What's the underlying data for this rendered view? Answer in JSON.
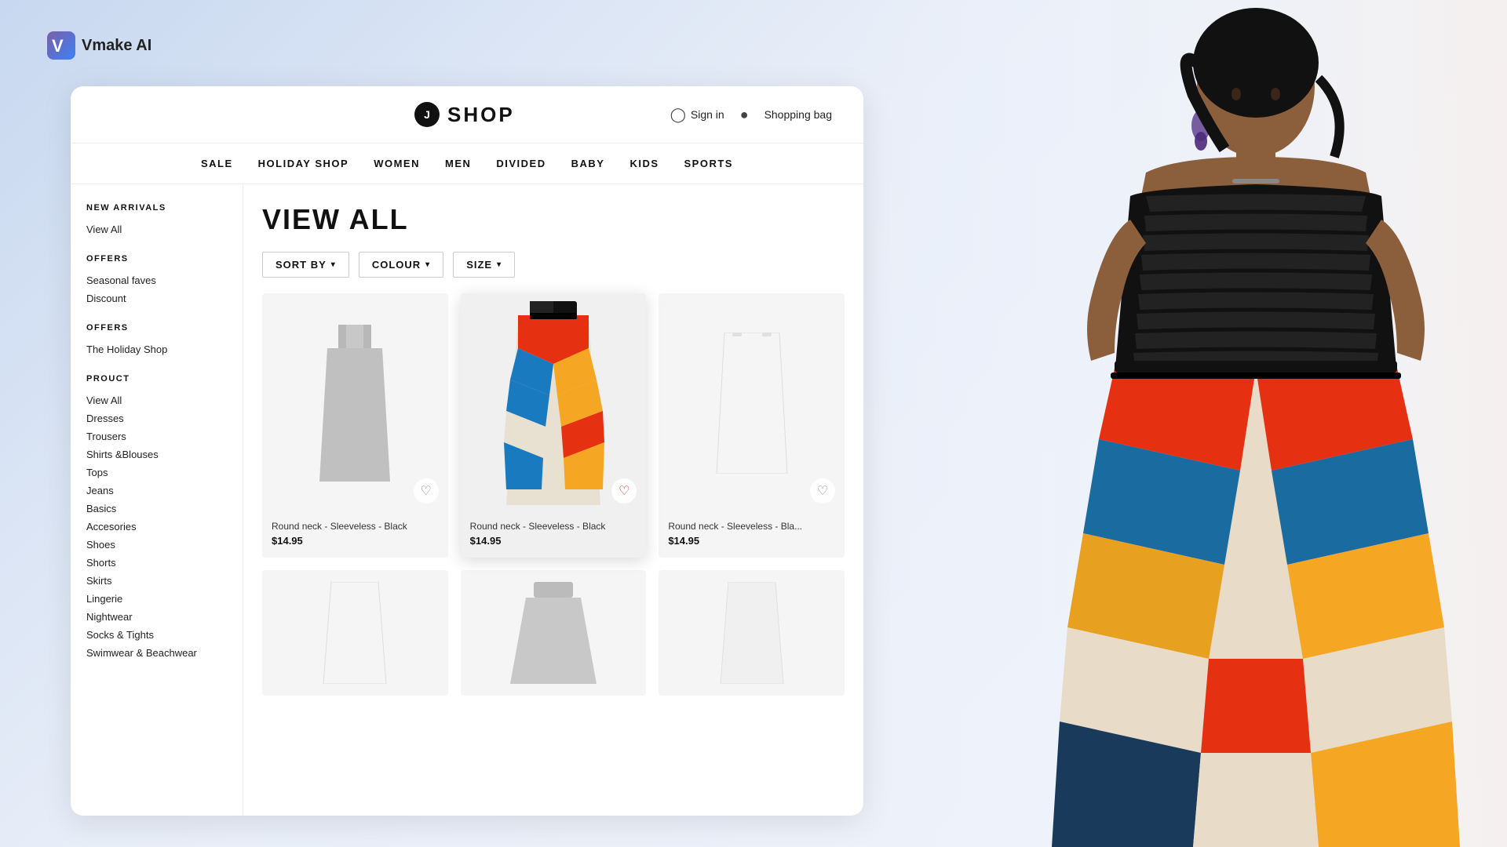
{
  "vmake": {
    "logo_text": "Vmake AI"
  },
  "shop": {
    "title": "SHOP",
    "logo_symbol": "J"
  },
  "header": {
    "sign_in": "Sign in",
    "shopping_bag": "Shopping bag"
  },
  "nav": {
    "items": [
      {
        "label": "SALE"
      },
      {
        "label": "HOLIDAY SHOP"
      },
      {
        "label": "WOMEN"
      },
      {
        "label": "MEN"
      },
      {
        "label": "DIVIDED"
      },
      {
        "label": "BABY"
      },
      {
        "label": "KIDS"
      },
      {
        "label": "SPORTS"
      }
    ]
  },
  "sidebar": {
    "sections": [
      {
        "title": "NEW ARRIVALS",
        "links": [
          "View All"
        ]
      },
      {
        "title": "OFFERS",
        "links": [
          "Seasonal faves",
          "Discount"
        ]
      },
      {
        "title": "OFFERS",
        "links": [
          "The Holiday Shop"
        ]
      },
      {
        "title": "PROUCT",
        "links": [
          "View All",
          "Dresses",
          "Trousers",
          "Shirts &Blouses",
          "Tops",
          "Jeans",
          "Basics",
          "Accesories",
          "Shoes",
          "Shorts",
          "Skirts",
          "Lingerie",
          "Nightwear",
          "Socks & Tights",
          "Swimwear & Beachwear"
        ]
      }
    ]
  },
  "page_title": "VIEW ALL",
  "filters": {
    "sort_by": "SORT BY",
    "colour": "COLOUR",
    "size": "SIZE"
  },
  "products": [
    {
      "id": 1,
      "name": "Round neck - Sleeveless - Black",
      "price": "$14.95",
      "type": "gray_dress",
      "featured": false
    },
    {
      "id": 2,
      "name": "Round neck - Sleeveless - Black",
      "price": "$14.95",
      "type": "colorful_dress",
      "featured": true
    },
    {
      "id": 3,
      "name": "Round neck - Sleeveless - Bla...",
      "price": "$14.95",
      "type": "white_top",
      "featured": false
    }
  ],
  "row2_products": [
    {
      "id": 4,
      "name": "",
      "price": "",
      "type": "white_item"
    },
    {
      "id": 5,
      "name": "",
      "price": "",
      "type": "gray_skirt"
    },
    {
      "id": 6,
      "name": "",
      "price": "",
      "type": "white_item2"
    }
  ]
}
